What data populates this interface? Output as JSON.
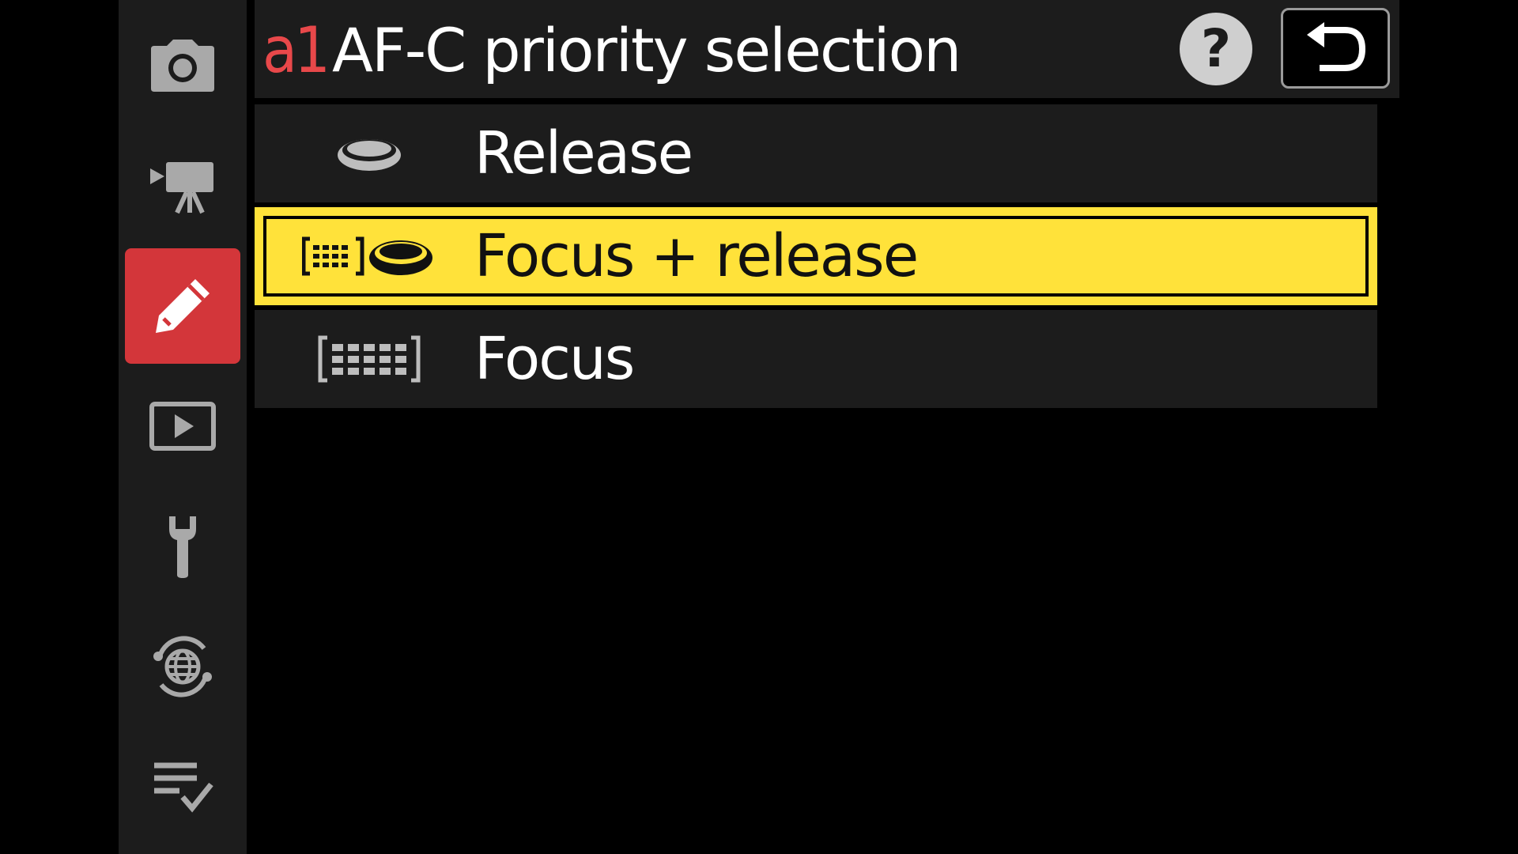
{
  "header": {
    "code": "a1",
    "title": "AF-C priority selection",
    "help_label": "?"
  },
  "sidebar": {
    "items": [
      {
        "icon": "camera-icon",
        "active": false
      },
      {
        "icon": "movie-camera-icon",
        "active": false
      },
      {
        "icon": "pencil-icon",
        "active": true
      },
      {
        "icon": "playback-icon",
        "active": false
      },
      {
        "icon": "wrench-icon",
        "active": false
      },
      {
        "icon": "network-icon",
        "active": false
      },
      {
        "icon": "my-menu-icon",
        "active": false
      }
    ]
  },
  "menu": {
    "items": [
      {
        "label": "Release",
        "icon": "release-icon",
        "selected": false
      },
      {
        "label": "Focus + release",
        "icon": "focus-release-icon",
        "selected": true
      },
      {
        "label": "Focus",
        "icon": "focus-icon",
        "selected": false
      }
    ]
  },
  "colors": {
    "accent_red": "#d3363a",
    "selection_yellow": "#ffe23a",
    "panel_bg": "#1c1c1c",
    "background": "#000000"
  }
}
